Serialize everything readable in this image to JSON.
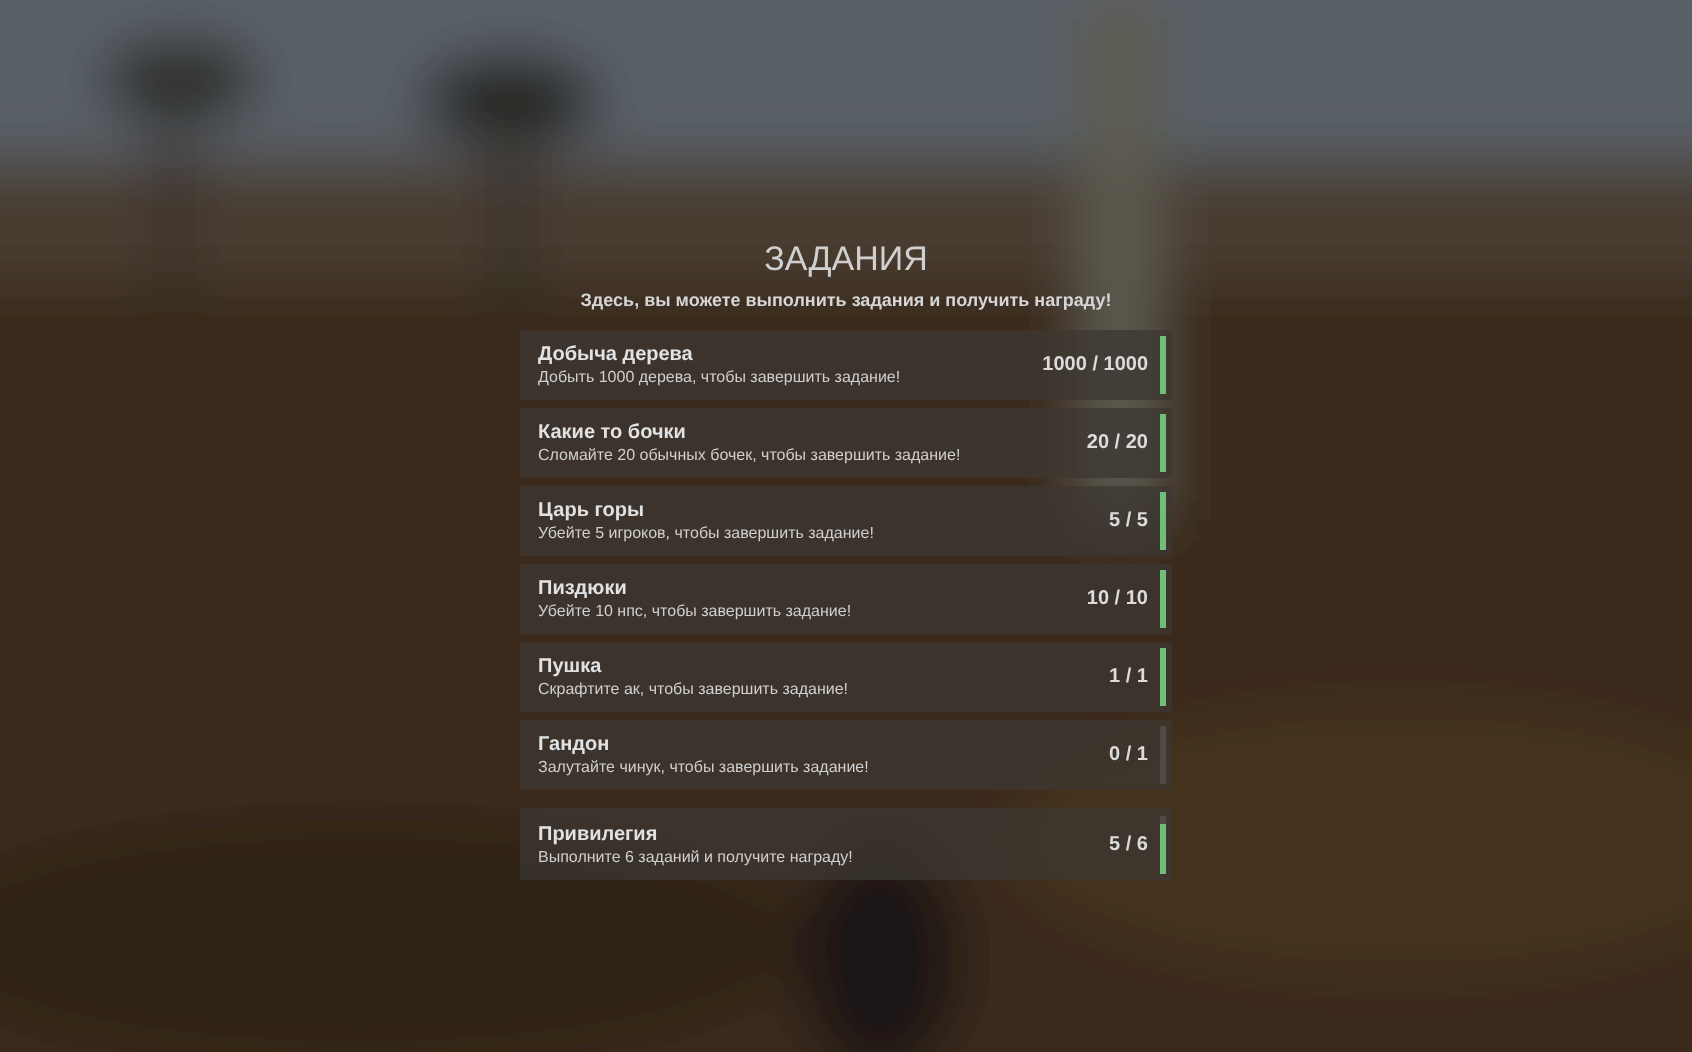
{
  "title": "ЗАДАНИЯ",
  "subtitle": "Здесь, вы можете выполнить задания и получить награду!",
  "quests": [
    {
      "name": "Добыча дерева",
      "description": "Добыть 1000 дерева, чтобы завершить задание!",
      "progress": "1000 / 1000",
      "level": 1
    },
    {
      "name": "Какие то бочки",
      "description": "Сломайте 20 обычных бочек, чтобы завершить задание!",
      "progress": "20 / 20",
      "level": 1
    },
    {
      "name": "Царь горы",
      "description": "Убейте 5 игроков, чтобы завершить задание!",
      "progress": "5 / 5",
      "level": 1
    },
    {
      "name": "Пиздюки",
      "description": "Убейте 10 нпс, чтобы завершить задание!",
      "progress": "10 / 10",
      "level": 1
    },
    {
      "name": "Пушка",
      "description": "Скрафтите ак, чтобы завершить задание!",
      "progress": "1 / 1",
      "level": 1
    },
    {
      "name": "Гандон",
      "description": "Залутайте чинук, чтобы завершить задание!",
      "progress": "0 / 1",
      "level": 0
    }
  ],
  "reward": {
    "name": "Привилегия",
    "description": "Выполните 6 заданий и получите награду!",
    "progress": "5 / 6",
    "level": 0.83
  }
}
